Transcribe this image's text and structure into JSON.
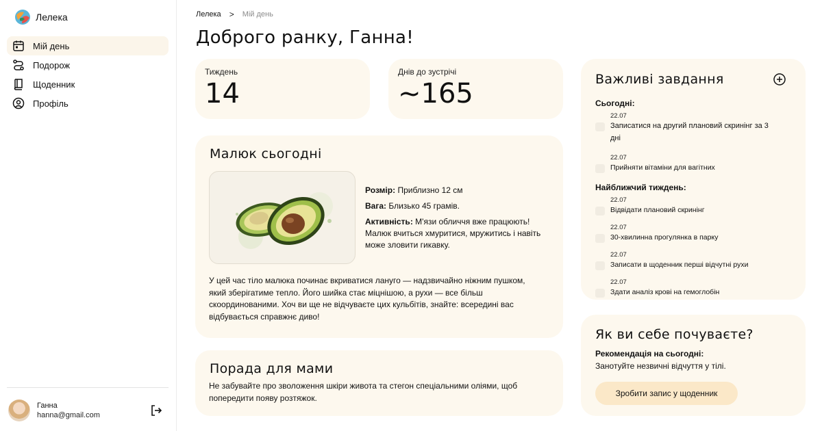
{
  "app": {
    "name": "Лелека"
  },
  "sidebar": {
    "items": [
      {
        "label": "Мій день",
        "icon": "calendar-icon",
        "active": true
      },
      {
        "label": "Подорож",
        "icon": "route-icon",
        "active": false
      },
      {
        "label": "Щоденник",
        "icon": "book-icon",
        "active": false
      },
      {
        "label": "Профіль",
        "icon": "user-circle-icon",
        "active": false
      }
    ],
    "user": {
      "name": "Ганна",
      "email": "hanna@gmail.com"
    }
  },
  "breadcrumb": {
    "home": "Лелека",
    "separator": ">",
    "current": "Мій день"
  },
  "page_title": "Доброго ранку, Ганна!",
  "stats": {
    "week": {
      "label": "Тиждень",
      "value": "14"
    },
    "days": {
      "label": "Днів до зустрічі",
      "value": "~165"
    }
  },
  "baby": {
    "title": "Малюк сьогодні",
    "image": "avocado-illustration",
    "size_label": "Розмір:",
    "size_value": "Приблизно 12 см",
    "weight_label": "Вага:",
    "weight_value": "Близько 45 грамів.",
    "activity_label": "Активність:",
    "activity_value": "М'язи обличчя вже працюють! Малюк вчиться хмуритися, мружитись і навіть може зловити гикавку.",
    "description": "У цей час тіло малюка починає вкриватися лануго — надзвичайно ніжним пушком, який зберігатиме тепло. Його шийка стає міцнішою, а рухи — все більш скоординованими. Хоч ви ще не відчуваєте цих кульбітів, знайте: всередині вас відбувається справжнє диво!"
  },
  "tip": {
    "title": "Порада для мами",
    "text": "Не забувайте про зволоження шкіри живота та стегон спеціальними оліями, щоб попередити появу розтяжок."
  },
  "tasks": {
    "title": "Важливі завдання",
    "today_label": "Сьогодні:",
    "today": [
      {
        "date": "22.07",
        "label": "Записатися на другий плановий скринінг за 3 дні",
        "done": false
      },
      {
        "date": "22.07",
        "label": "Прийняти вітаміни для вагітних",
        "done": false
      }
    ],
    "week_label": "Найближчий тиждень:",
    "week": [
      {
        "date": "22.07",
        "label": "Відвідати плановий скринінг",
        "done": false
      },
      {
        "date": "22.07",
        "label": "30-хвилинна прогулянка в парку",
        "done": false
      },
      {
        "date": "22.07",
        "label": "Записати в щоденник перші відчутні рухи",
        "done": false
      },
      {
        "date": "22.07",
        "label": "Здати аналіз крові на гемоглобін",
        "done": false
      }
    ]
  },
  "feeling": {
    "title": "Як ви себе почуваєте?",
    "recommendation_label": "Рекомендація на сьогодні:",
    "recommendation": "Занотуйте незвичні відчуття у тілі.",
    "button": "Зробити запис у щоденник"
  },
  "colors": {
    "card_bg": "#fdf8ee",
    "active_nav": "#fbf5ea",
    "button_bg": "#fbe8c8",
    "checkbox": "#f1ece2"
  }
}
